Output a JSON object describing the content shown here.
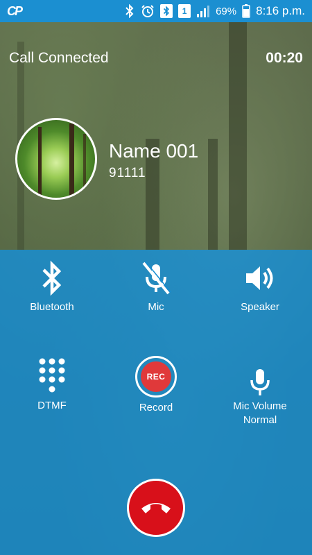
{
  "status_bar": {
    "app_logo": "CP",
    "battery": "69%",
    "time": "8:16 p.m.",
    "sim_label": "1",
    "icons": [
      "bluetooth-icon",
      "alarm-icon",
      "bluetooth-box-icon",
      "sim-icon",
      "signal-icon",
      "battery-icon"
    ]
  },
  "call": {
    "status": "Call Connected",
    "timer": "00:20"
  },
  "contact": {
    "name": "Name 001",
    "number": "91111"
  },
  "controls": [
    {
      "label": "Bluetooth",
      "icon": "bluetooth-icon"
    },
    {
      "label": "Mic",
      "icon": "mic-muted-icon"
    },
    {
      "label": "Speaker",
      "icon": "speaker-icon"
    },
    {
      "label": "DTMF",
      "icon": "dialpad-icon"
    },
    {
      "label": "Record",
      "icon": "record-icon",
      "badge": "REC"
    },
    {
      "label": "Mic Volume",
      "sublabel": "Normal",
      "icon": "microphone-icon"
    }
  ],
  "colors": {
    "panel": "#168cd2",
    "status_bar": "#1b8fd1",
    "hangup": "#d8101a",
    "record": "#e0393a"
  }
}
